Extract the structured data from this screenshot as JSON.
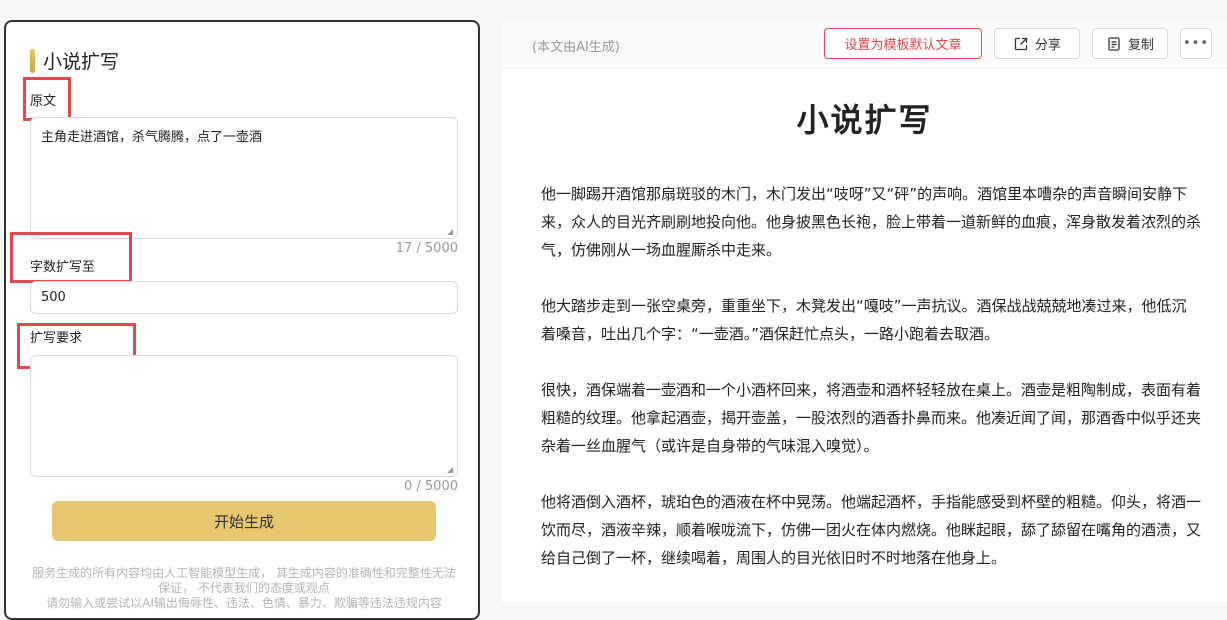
{
  "left": {
    "title": "小说扩写",
    "original_label": "原文",
    "original_value": "主角走进酒馆，杀气腾腾，点了一壶酒",
    "original_counter": "17 / 5000",
    "wordcount_label": "字数扩写至",
    "wordcount_value": "500",
    "requirements_label": "扩写要求",
    "requirements_value": "",
    "requirements_counter": "0 / 5000",
    "generate_button": "开始生成",
    "disclaimer_line1": "服务生成的所有内容均由人工智能模型生成， 其生成内容的准确性和完整性无法",
    "disclaimer_line2": "保证， 不代表我们的态度或观点",
    "disclaimer_line3": "请勿输入或尝试以AI输出侮辱性、违法、色情、暴力、欺骗等违法违规内容"
  },
  "right": {
    "ai_note": "(本文由AI生成)",
    "template_button": "设置为模板默认文章",
    "share_button": "分享",
    "copy_button": "复制",
    "more_button": "•••",
    "doc_title": "小说扩写",
    "paragraphs": [
      "他一脚踢开酒馆那扇斑驳的木门，木门发出“吱呀”又“砰”的声响。酒馆里本嘈杂的声音瞬间安静下来，众人的目光齐刷刷地投向他。他身披黑色长袍，脸上带着一道新鲜的血痕，浑身散发着浓烈的杀气，仿佛刚从一场血腥厮杀中走来。",
      "他大踏步走到一张空桌旁，重重坐下，木凳发出“嘎吱”一声抗议。酒保战战兢兢地凑过来，他低沉着嗓音，吐出几个字：“一壶酒。”酒保赶忙点头，一路小跑着去取酒。",
      "很快，酒保端着一壶酒和一个小酒杯回来，将酒壶和酒杯轻轻放在桌上。酒壶是粗陶制成，表面有着粗糙的纹理。他拿起酒壶，揭开壶盖，一股浓烈的酒香扑鼻而来。他凑近闻了闻，那酒香中似乎还夹杂着一丝血腥气（或许是自身带的气味混入嗅觉）。",
      "他将酒倒入酒杯，琥珀色的酒液在杯中晃荡。他端起酒杯，手指能感受到杯壁的粗糙。仰头，将酒一饮而尽，酒液辛辣，顺着喉咙流下，仿佛一团火在体内燃烧。他眯起眼，舔了舔留在嘴角的酒渍，又给自己倒了一杯，继续喝着，周围人的目光依旧时不时地落在他身上。"
    ]
  },
  "colors": {
    "accent": "#e8c86e",
    "highlight_red": "#e0484c"
  }
}
